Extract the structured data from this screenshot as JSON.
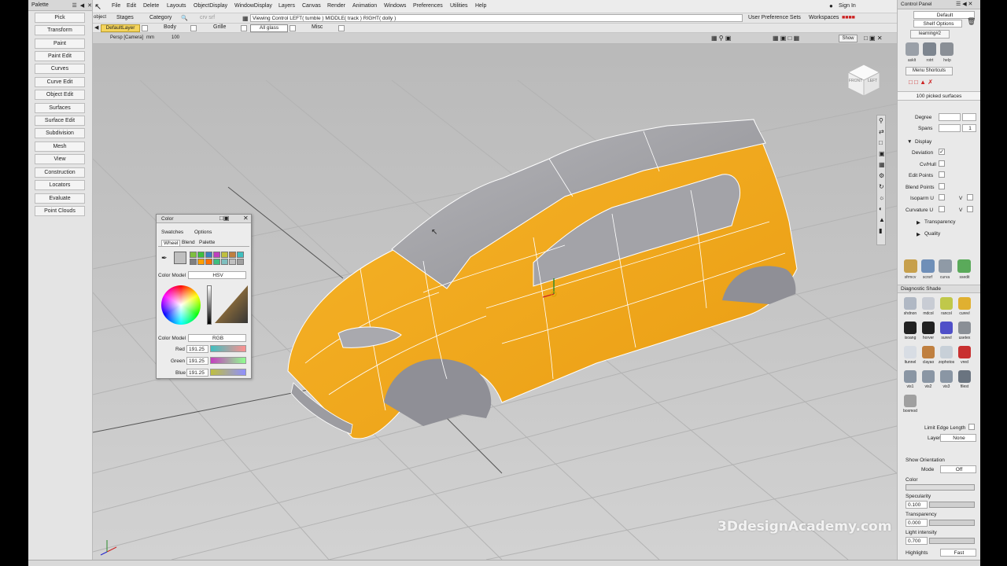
{
  "palette": {
    "title": "Palette",
    "buttons": [
      "Pick",
      "Transform",
      "Paint",
      "Paint Edit",
      "Curves",
      "Curve Edit",
      "Object Edit",
      "Surfaces",
      "Surface Edit",
      "Subdivision",
      "Mesh",
      "View",
      "Construction",
      "Locators",
      "Evaluate",
      "Point Clouds"
    ]
  },
  "menubar": {
    "items": [
      "File",
      "Edit",
      "Delete",
      "Layouts",
      "ObjectDisplay",
      "WindowDisplay",
      "Layers",
      "Canvas",
      "Render",
      "Animation",
      "Windows",
      "Preferences",
      "Utilities",
      "Help"
    ],
    "sign_in": "Sign In"
  },
  "toolbar2": {
    "object_label": "object",
    "stages": "Stages",
    "category": "Category",
    "placeholder": "crv srf",
    "viewing_control": "Viewing Control   LEFT( tumble )   MIDDLE( track )   RIGHT( dolly )",
    "user_prefs": "User Preference Sets",
    "workspaces": "Workspaces"
  },
  "toolbar3": {
    "layers": [
      "DefaultLayer",
      "Body",
      "Grille",
      "All glass",
      "Misc"
    ]
  },
  "viewport": {
    "camera_label": "Persp [Camera]",
    "units": "mm",
    "zoom": "100",
    "show_label": "Show",
    "cube_front": "FRONT",
    "cube_left": "LEFT"
  },
  "color_dialog": {
    "title": "Color",
    "menu": [
      "Swatches",
      "Options"
    ],
    "tabs": [
      "Wheel",
      "Blend",
      "Palette"
    ],
    "model_label": "Color Model",
    "model_value": "HSV",
    "model2_label": "Color Model",
    "model2_value": "RGB",
    "channels": [
      {
        "name": "Red",
        "value": "191.25"
      },
      {
        "name": "Green",
        "value": "191.25"
      },
      {
        "name": "Blue",
        "value": "191.25"
      }
    ],
    "swatch_colors": [
      "#7fbf3f",
      "#3fbf3f",
      "#3f7fbf",
      "#bf3fbf",
      "#bfbf3f",
      "#bf7f3f",
      "#3fbfbf",
      "#7f7f7f",
      "#ff9f00",
      "#ff6f00",
      "#3fbf7f",
      "#7fbfbf",
      "#bfbfbf",
      "#9f9f9f"
    ]
  },
  "control_panel": {
    "title": "Control Panel",
    "preset": "Default",
    "shelf_options": "Shelf Options",
    "shelf_tab": "learning#2",
    "shelf_icons": [
      "asklt",
      "rotrt",
      "help"
    ],
    "menu_shortcuts": "Menu Shortcuts",
    "picked": "100 picked surfaces",
    "degree_label": "Degree",
    "spans_label": "Spans",
    "spans_value": "1",
    "display_label": "Display",
    "display_items": [
      "Deviation",
      "Cv/Hull",
      "Edit Points",
      "Blend Points",
      "Isoparm U",
      "Curvature U"
    ],
    "v_label": "V",
    "transparency_label": "Transparency",
    "quality_label": "Quality",
    "tool_icons": [
      "sfrmcv",
      "scrsrf",
      "curva",
      "ssedit"
    ],
    "diag_title": "Diagnostic Shade",
    "diag_icons": [
      "shdnon",
      "mdcol",
      "rancol",
      "curevl",
      "isoang",
      "horver",
      "surevl",
      "usetex",
      "ltunnel",
      "clayao",
      "zophotos",
      "vred",
      "vis1",
      "vis2",
      "vis3",
      "filest",
      "boxmod"
    ],
    "limit_edge": "Limit Edge Length",
    "layer_label": "Layer",
    "layer_value": "None",
    "show_orientation": "Show Orientation",
    "mode_label": "Mode",
    "mode_value": "Off",
    "color_label": "Color",
    "specularity_label": "Specularity",
    "specularity_value": "0.100",
    "transparency2_label": "Transparency",
    "transparency2_value": "0.000",
    "light_label": "Light intensity",
    "light_value": "0.700",
    "highlights_label": "Highlights",
    "highlights_value": "Fast"
  },
  "watermark": "3DdesignAcademy.com",
  "colors": {
    "car_body": "#f0a81a",
    "glass": "#a9a9ad",
    "viewport_bg": "#c8c8c8",
    "ui_bg": "#e9e9e9"
  }
}
